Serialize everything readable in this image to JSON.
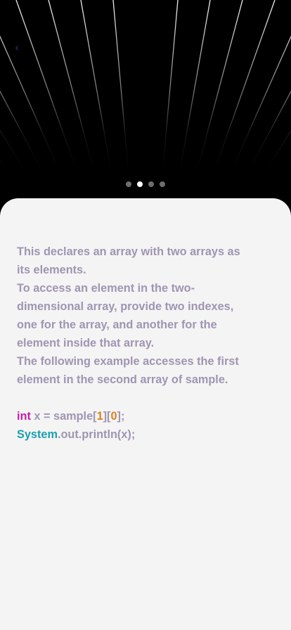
{
  "hero": {
    "back_glyph": "‹",
    "back_icon": "chevron-left-icon",
    "colors": {
      "background": "#000000",
      "grid": "#ffffff"
    }
  },
  "pager": {
    "total": 4,
    "current": 2
  },
  "lesson": {
    "paragraphs": [
      "This declares an array with two arrays as its elements.",
      "To access an element in the two-dimensional array, provide two indexes, one for the array, and another for the element inside that array.",
      "The following example accesses the first element in the second array of sample."
    ],
    "code": {
      "line1": {
        "keyword": "int",
        "text_a": " x = sample[",
        "index_a": "1",
        "text_b": "][",
        "index_b": "0",
        "text_c": "];"
      },
      "line2": {
        "class_name": "System",
        "text": ".out.println(x);"
      }
    }
  },
  "colors": {
    "text": "#a095b2",
    "keyword": "#c21fa6",
    "class_name": "#1aa0ad",
    "number": "#e0801a",
    "card_background": "#f4f4f4",
    "dot_active": "#ffffff",
    "dot_inactive": "#6e6e6e"
  }
}
